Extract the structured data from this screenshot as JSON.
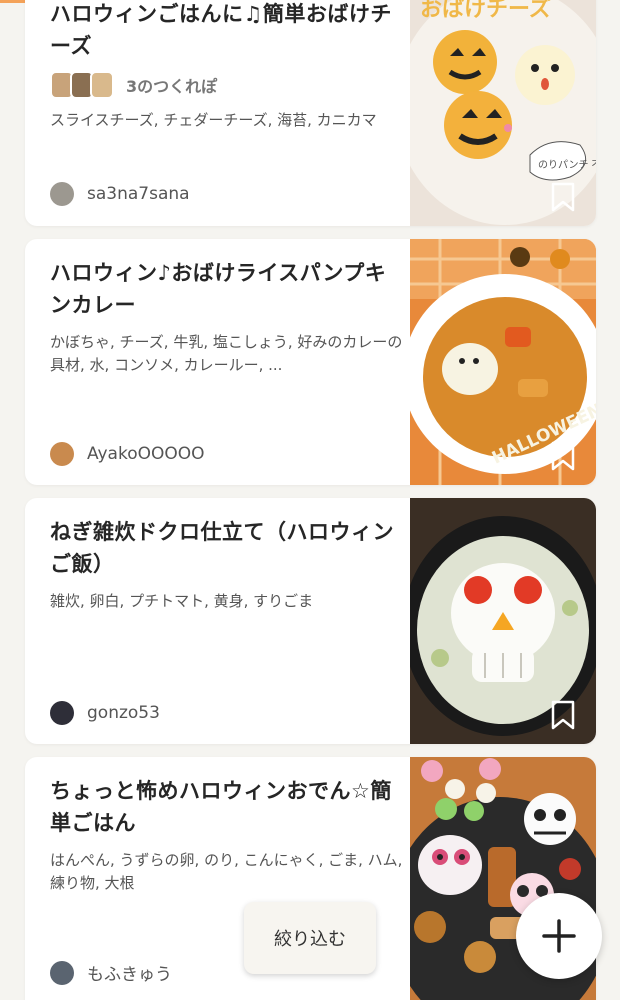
{
  "recipes": [
    {
      "title": "ハロウィンごはんに♫簡単おばけチーズ",
      "reports_label": "3のつくれぽ",
      "ingredients": "スライスチーズ, チェダーチーズ, 海苔, カニカマ",
      "author": "sa3na7sana"
    },
    {
      "title": "ハロウィン♪おばけライスパンプキンカレー",
      "ingredients": "かぼちゃ, チーズ, 牛乳, 塩こしょう, 好みのカレーの具材, 水, コンソメ, カレールー, ...",
      "author": "AyakoOOOOO"
    },
    {
      "title": "ねぎ雑炊ドクロ仕立て（ハロウィンご飯）",
      "ingredients": "雑炊, 卵白, プチトマト, 黄身, すりごま",
      "author": "gonzo53"
    },
    {
      "title": "ちょっと怖めハロウィンおでん☆簡単ごはん",
      "ingredients": "はんぺん, うずらの卵, のり, こんにゃく, ごま, ハム, 練り物, 大根",
      "author": "もふきゅう"
    }
  ],
  "thumb_text": {
    "r1_banner": "おばけチーズ",
    "r1_bubble": "のりパンチ 不要",
    "r2_halloween": "HALLOWEEN"
  },
  "filter_button": "絞り込む",
  "icons": {
    "bookmark": "bookmark-icon",
    "add": "plus-icon"
  },
  "colors": {
    "accent": "#f4a259",
    "background": "#f5f4f0"
  }
}
